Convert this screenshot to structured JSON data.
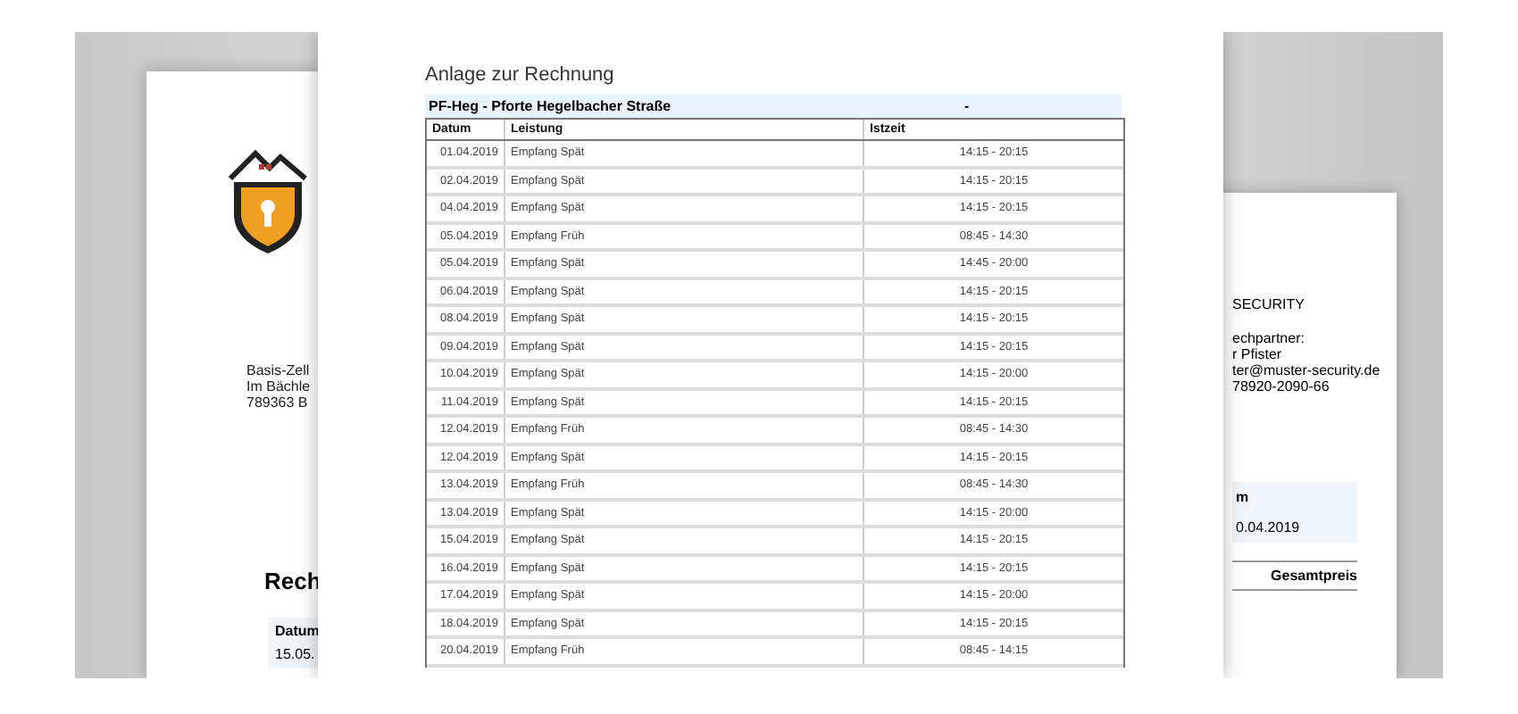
{
  "left_page": {
    "address": [
      "Basis-Zell",
      "Im Bächle",
      "789363 B"
    ],
    "heading": "Rech",
    "date_label": "Datum",
    "date_value": "15.05."
  },
  "right_page": {
    "company": "SECURITY",
    "contact": [
      "echpartner:",
      "r Pfister",
      "ter@muster-security.de",
      "78920-2090-66"
    ],
    "info_label": "m",
    "info_value": "0.04.2019",
    "column": "Gesamtpreis"
  },
  "document": {
    "title": "Anlage zur Rechnung",
    "location": "PF-Heg - Pforte Hegelbacher Straße",
    "location_value": "-",
    "columns": [
      "Datum",
      "Leistung",
      "Istzeit"
    ],
    "rows": [
      [
        "01.04.2019",
        "Empfang Spät",
        "14:15 - 20:15"
      ],
      [
        "02.04.2019",
        "Empfang Spät",
        "14:15 - 20:15"
      ],
      [
        "04.04.2019",
        "Empfang Spät",
        "14:15 - 20:15"
      ],
      [
        "05.04.2019",
        "Empfang Früh",
        "08:45 - 14:30"
      ],
      [
        "05.04.2019",
        "Empfang Spät",
        "14:45 - 20:00"
      ],
      [
        "06.04.2019",
        "Empfang Spät",
        "14:15 - 20:15"
      ],
      [
        "08.04.2019",
        "Empfang Spät",
        "14:15 - 20:15"
      ],
      [
        "09.04.2019",
        "Empfang Spät",
        "14:15 - 20:15"
      ],
      [
        "10.04.2019",
        "Empfang Spät",
        "14:15 - 20:00"
      ],
      [
        "11.04.2019",
        "Empfang Spät",
        "14:15 - 20:15"
      ],
      [
        "12.04.2019",
        "Empfang Früh",
        "08:45 - 14:30"
      ],
      [
        "12.04.2019",
        "Empfang Spät",
        "14:15 - 20:15"
      ],
      [
        "13.04.2019",
        "Empfang Früh",
        "08:45 - 14:30"
      ],
      [
        "13.04.2019",
        "Empfang Spät",
        "14:15 - 20:00"
      ],
      [
        "15.04.2019",
        "Empfang Spät",
        "14:15 - 20:15"
      ],
      [
        "16.04.2019",
        "Empfang Spät",
        "14:15 - 20:15"
      ],
      [
        "17.04.2019",
        "Empfang Spät",
        "14:15 - 20:00"
      ],
      [
        "18.04.2019",
        "Empfang Spät",
        "14:15 - 20:15"
      ],
      [
        "20.04.2019",
        "Empfang Früh",
        "08:45 - 14:15"
      ]
    ]
  }
}
